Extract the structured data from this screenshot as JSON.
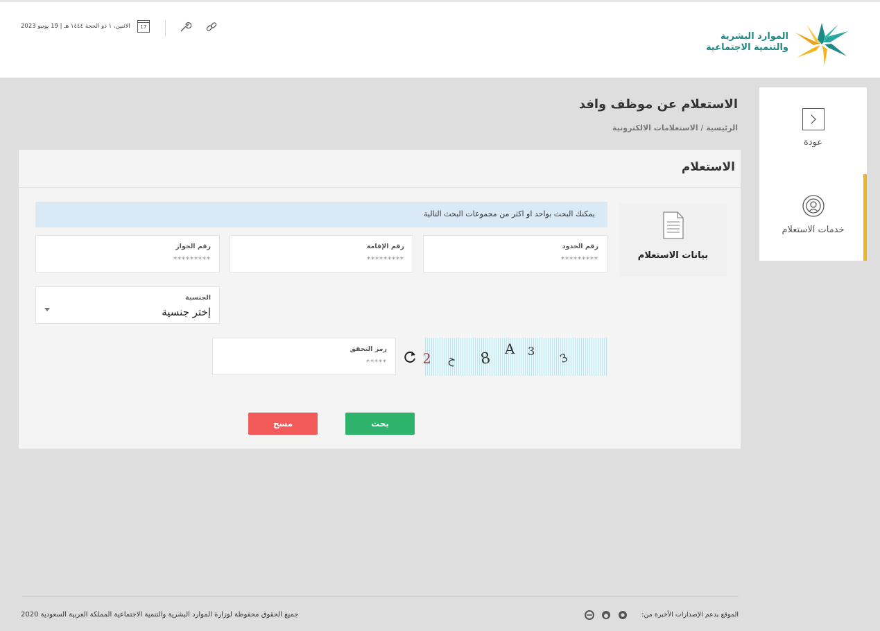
{
  "header": {
    "logo_line1": "الموارد البشرية",
    "logo_line2": "والتنمية الاجتماعية",
    "date": "الاثنين، ١ ذو الحجة ١٤٤٤ هـ | 19 يونيو 2023",
    "calendar_day": "17",
    "icons": [
      "calendar-icon",
      "wrench-icon",
      "link-icon"
    ]
  },
  "side": {
    "back_label": "عودة",
    "services_label": "خدمات الاستعلام",
    "accent_color": "#f2b51c"
  },
  "page": {
    "title": "الاستعلام عن موظف وافد",
    "breadcrumb": "الرئيسية / الاستعلامات الالكترونية"
  },
  "card": {
    "title": "الاستعلام",
    "tile_label": "بيانات الاستعلام",
    "info": "يمكنك البحث بواحد او اكثر من مجموعات البحث التالية",
    "fields": {
      "border_number": {
        "label": "رقم الحدود",
        "value": "*********"
      },
      "iqama_number": {
        "label": "رقم الإقامة",
        "value": "*********"
      },
      "passport_number": {
        "label": "رقم الجواز",
        "value": "*********"
      },
      "nationality": {
        "label": "الجنسية",
        "value": "إختر جنسية"
      },
      "captcha_code": {
        "label": "رمز التحقق",
        "value": "*****"
      }
    },
    "captcha_chars": [
      "2",
      "ح",
      "8",
      "A",
      "3",
      "3"
    ],
    "search_label": "بحث",
    "clear_label": "مسح",
    "search_color": "#2db36b",
    "clear_color": "#f25a5a"
  },
  "footer": {
    "copyright": "جميع الحقوق محفوظة لوزارة الموارد البشرية والتنمية الاجتماعية المملكة العربية السعودية 2020",
    "support": "الموقع يدعم الإصدارات الأخيرة من:",
    "browsers": [
      "chrome-icon",
      "firefox-icon",
      "ie-icon"
    ]
  }
}
